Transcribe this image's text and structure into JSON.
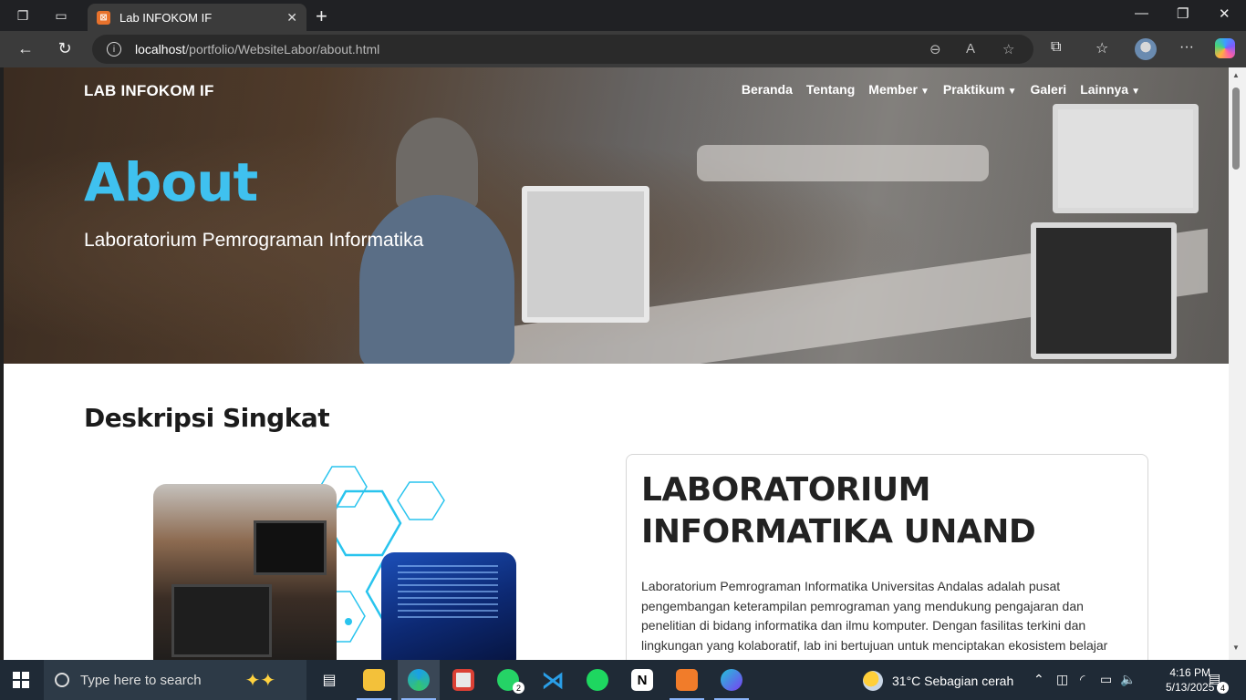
{
  "browser": {
    "tab_title": "Lab INFOKOM IF",
    "url_host": "localhost",
    "url_path": "/portfolio/WebsiteLabor/about.html"
  },
  "site": {
    "brand": "LAB INFOKOM IF",
    "nav": [
      {
        "label": "Beranda",
        "dropdown": false
      },
      {
        "label": "Tentang",
        "dropdown": false
      },
      {
        "label": "Member",
        "dropdown": true
      },
      {
        "label": "Praktikum",
        "dropdown": true
      },
      {
        "label": "Galeri",
        "dropdown": false
      },
      {
        "label": "Lainnya",
        "dropdown": true
      }
    ],
    "hero": {
      "title": "About",
      "subtitle": "Laboratorium Pemrograman Informatika"
    },
    "section": {
      "title": "Deskripsi Singkat",
      "card_title": "LABORATORIUM INFORMATIKA UNAND",
      "card_text": "Laboratorium Pemrograman Informatika Universitas Andalas adalah pusat pengembangan keterampilan pemrograman yang mendukung pengajaran dan penelitian di bidang informatika dan ilmu komputer. Dengan fasilitas terkini dan lingkungan yang kolaboratif, lab ini bertujuan untuk menciptakan ekosistem belajar"
    }
  },
  "taskbar": {
    "search_placeholder": "Type here to search",
    "weather": "31°C  Sebagian cerah",
    "time": "4:16 PM",
    "date": "5/13/2025",
    "whatsapp_badge": "2",
    "notification_count": "4"
  },
  "colors": {
    "accent": "#3fc1ef",
    "taskbar": "#1f2a36"
  }
}
